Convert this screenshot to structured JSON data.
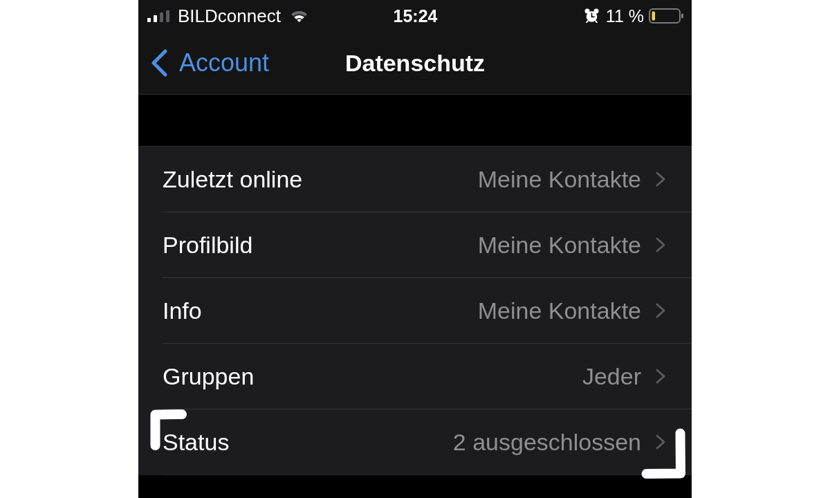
{
  "status_bar": {
    "carrier": "BILDconnect",
    "time": "15:24",
    "battery_percent": "11 %"
  },
  "navigation": {
    "back_label": "Account",
    "title": "Datenschutz"
  },
  "rows": [
    {
      "label": "Zuletzt online",
      "value": "Meine Kontakte",
      "marked": false
    },
    {
      "label": "Profilbild",
      "value": "Meine Kontakte",
      "marked": false
    },
    {
      "label": "Info",
      "value": "Meine Kontakte",
      "marked": false
    },
    {
      "label": "Gruppen",
      "value": "Jeder",
      "marked": false
    },
    {
      "label": "Status",
      "value": "2 ausgeschlossen",
      "marked": true
    }
  ]
}
